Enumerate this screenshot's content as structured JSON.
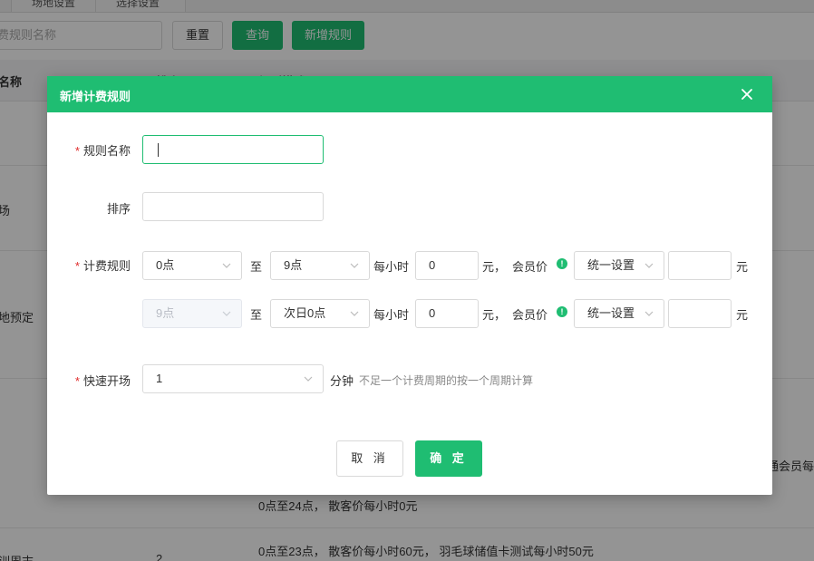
{
  "background": {
    "tabs": [
      "场地设置",
      "选择设置"
    ],
    "search_placeholder": "费规则名称",
    "buttons": {
      "reset": "重置",
      "query": "查询",
      "add": "新增规则"
    },
    "columns": [
      "名称",
      "排序",
      "规则描述"
    ],
    "rows": [
      {
        "name": "",
        "sort": "",
        "desc": ""
      },
      {
        "name": "场",
        "sort": "",
        "desc": ""
      },
      {
        "name": "地预定",
        "sort": "",
        "desc": ""
      },
      {
        "name": "",
        "sort": "",
        "desc": ""
      },
      {
        "name": "",
        "sort": "",
        "desc": "0点至24点， 散客价每小时0元",
        "extra": "通会员每"
      },
      {
        "name": "训周末",
        "sort": "2",
        "desc": "0点至23点， 散客价每小时60元， 羽毛球储值卡测试每小时50元"
      }
    ]
  },
  "modal": {
    "title": "新增计费规则",
    "fields": {
      "rule_name": {
        "label": "规则名称",
        "value": ""
      },
      "sort": {
        "label": "排序",
        "value": ""
      },
      "billing": {
        "label": "计费规则",
        "rows": [
          {
            "from": "0点",
            "to_text": "至",
            "to": "9点",
            "per_hour": "每小时",
            "price": "0",
            "yuan_comma": "元，",
            "member_label": "会员价",
            "member_select": "统一设置",
            "member_price": "",
            "yuan": "元",
            "from_disabled": false
          },
          {
            "from": "9点",
            "to_text": "至",
            "to": "次日0点",
            "per_hour": "每小时",
            "price": "0",
            "yuan_comma": "元，",
            "member_label": "会员价",
            "member_select": "统一设置",
            "member_price": "",
            "yuan": "元",
            "from_disabled": true
          }
        ]
      },
      "quick_open": {
        "label": "快速开场",
        "value": "1",
        "unit": "分钟",
        "hint": "不足一个计费周期的按一个周期计算"
      }
    },
    "buttons": {
      "cancel": "取 消",
      "ok": "确 定"
    }
  },
  "colors": {
    "accent": "#1fbd72",
    "required": "#e02b2b",
    "overlay": "rgba(0,0,0,0.42)"
  },
  "icons": {
    "close": "close-icon",
    "chevron": "chevron-down-icon",
    "info": "info-icon"
  }
}
